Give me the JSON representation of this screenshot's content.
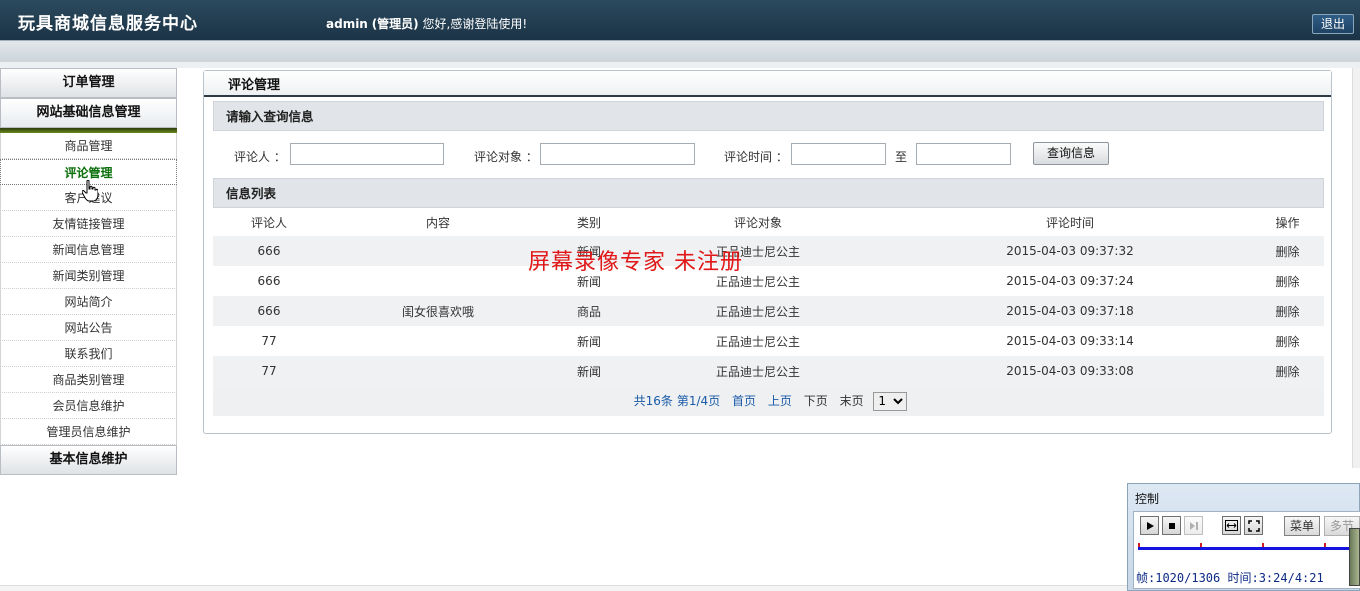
{
  "header": {
    "title": "玩具商城信息服务中心",
    "user": "admin",
    "role": "(管理员)",
    "greeting": "您好,感谢登陆使用!",
    "logout_label": "退出"
  },
  "sidebar": {
    "groups": [
      {
        "label": "订单管理"
      },
      {
        "label": "网站基础信息管理"
      },
      {
        "label": "基本信息维护"
      }
    ],
    "items": [
      {
        "label": "商品管理"
      },
      {
        "label": "评论管理"
      },
      {
        "label": "客户建议"
      },
      {
        "label": "友情链接管理"
      },
      {
        "label": "新闻信息管理"
      },
      {
        "label": "新闻类别管理"
      },
      {
        "label": "网站简介"
      },
      {
        "label": "网站公告"
      },
      {
        "label": "联系我们"
      },
      {
        "label": "商品类别管理"
      },
      {
        "label": "会员信息维护"
      },
      {
        "label": "管理员信息维护"
      }
    ]
  },
  "main": {
    "title": "评论管理",
    "query": {
      "section_title": "请输入查询信息",
      "reviewer_label": "评论人 ：",
      "reviewer_value": "",
      "target_label": "评论对象 ：",
      "target_value": "",
      "time_label": "评论时间 ：",
      "time_from_value": "",
      "to_label": "至",
      "time_to_value": "",
      "search_label": "查询信息"
    },
    "list": {
      "section_title": "信息列表",
      "columns": [
        "评论人",
        "内容",
        "类别",
        "评论对象",
        "评论时间",
        "操作"
      ],
      "rows": [
        {
          "user": "666",
          "content": "",
          "type": "新闻",
          "target": "正品迪士尼公主",
          "time": "2015-04-03 09:37:32",
          "op": "删除"
        },
        {
          "user": "666",
          "content": "",
          "type": "新闻",
          "target": "正品迪士尼公主",
          "time": "2015-04-03 09:37:24",
          "op": "删除"
        },
        {
          "user": "666",
          "content": "闺女很喜欢哦",
          "type": "商品",
          "target": "正品迪士尼公主",
          "time": "2015-04-03 09:37:18",
          "op": "删除"
        },
        {
          "user": "77",
          "content": "",
          "type": "新闻",
          "target": "正品迪士尼公主",
          "time": "2015-04-03 09:33:14",
          "op": "删除"
        },
        {
          "user": "77",
          "content": "",
          "type": "新闻",
          "target": "正品迪士尼公主",
          "time": "2015-04-03 09:33:08",
          "op": "删除"
        }
      ]
    },
    "pager": {
      "total": "共16条",
      "page_info": "第1/4页",
      "first": "首页",
      "prev": "上页",
      "next": "下页",
      "last": "末页",
      "page_select": "1"
    }
  },
  "watermark": "屏幕录像专家  未注册",
  "control": {
    "title": "控制",
    "menu_label": "菜单",
    "multi_label": "多节",
    "status": "帧:1020/1306 时间:3:24/4:21"
  }
}
